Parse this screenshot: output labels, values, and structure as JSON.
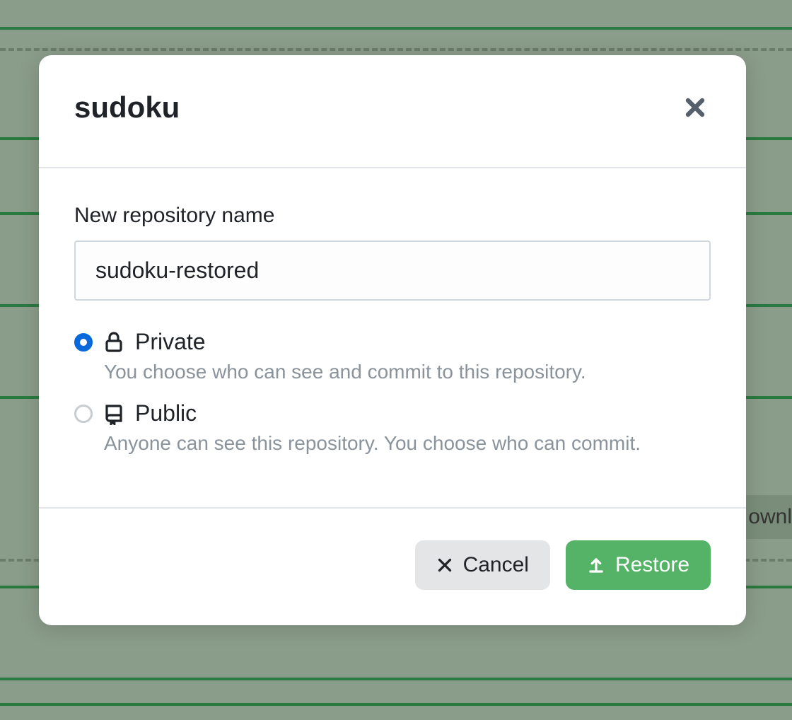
{
  "modal": {
    "title": "sudoku",
    "repo_name_label": "New repository name",
    "repo_name_value": "sudoku-restored",
    "visibility": {
      "private": {
        "label": "Private",
        "desc": "You choose who can see and commit to this repository.",
        "selected": true
      },
      "public": {
        "label": "Public",
        "desc": "Anyone can see this repository. You choose who can commit.",
        "selected": false
      }
    },
    "cancel_label": "Cancel",
    "restore_label": "Restore"
  },
  "background": {
    "partial_text": "ownl"
  }
}
